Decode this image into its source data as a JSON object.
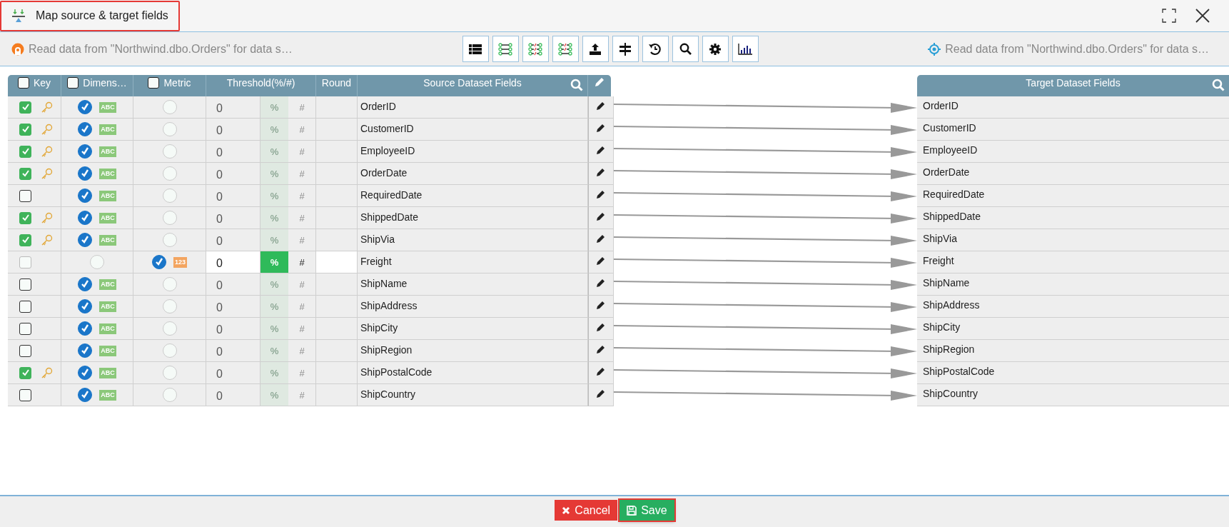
{
  "window": {
    "title": "Map source & target fields"
  },
  "source_status": "Read data from \"Northwind.dbo.Orders\" for data s…",
  "target_status": "Read data from \"Northwind.dbo.Orders\" for data s…",
  "columns": {
    "key": {
      "label": "Key",
      "checked": false
    },
    "dimension": {
      "label": "Dimens…",
      "checked": false
    },
    "metric": {
      "label": "Metric",
      "checked": false
    },
    "threshold": "Threshold(%/#)",
    "round": "Round",
    "source": "Source Dataset Fields",
    "target": "Target Dataset Fields"
  },
  "rows": [
    {
      "key": true,
      "dimension": true,
      "metric": false,
      "badge": "ABC",
      "threshold": "0",
      "percent": "%",
      "hash": "#",
      "source": "OrderID",
      "target": "OrderID"
    },
    {
      "key": true,
      "dimension": true,
      "metric": false,
      "badge": "ABC",
      "threshold": "0",
      "percent": "%",
      "hash": "#",
      "source": "CustomerID",
      "target": "CustomerID"
    },
    {
      "key": true,
      "dimension": true,
      "metric": false,
      "badge": "ABC",
      "threshold": "0",
      "percent": "%",
      "hash": "#",
      "source": "EmployeeID",
      "target": "EmployeeID"
    },
    {
      "key": true,
      "dimension": true,
      "metric": false,
      "badge": "ABC",
      "threshold": "0",
      "percent": "%",
      "hash": "#",
      "source": "OrderDate",
      "target": "OrderDate"
    },
    {
      "key": false,
      "dimension": true,
      "metric": false,
      "badge": "ABC",
      "threshold": "0",
      "percent": "%",
      "hash": "#",
      "source": "RequiredDate",
      "target": "RequiredDate"
    },
    {
      "key": true,
      "dimension": true,
      "metric": false,
      "badge": "ABC",
      "threshold": "0",
      "percent": "%",
      "hash": "#",
      "source": "ShippedDate",
      "target": "ShippedDate"
    },
    {
      "key": true,
      "dimension": true,
      "metric": false,
      "badge": "ABC",
      "threshold": "0",
      "percent": "%",
      "hash": "#",
      "source": "ShipVia",
      "target": "ShipVia"
    },
    {
      "key": false,
      "dimension": false,
      "metric": true,
      "badge": "123",
      "threshold": "0",
      "percent": "%",
      "hash": "#",
      "source": "Freight",
      "target": "Freight"
    },
    {
      "key": false,
      "dimension": true,
      "metric": false,
      "badge": "ABC",
      "threshold": "0",
      "percent": "%",
      "hash": "#",
      "source": "ShipName",
      "target": "ShipName"
    },
    {
      "key": false,
      "dimension": true,
      "metric": false,
      "badge": "ABC",
      "threshold": "0",
      "percent": "%",
      "hash": "#",
      "source": "ShipAddress",
      "target": "ShipAddress"
    },
    {
      "key": false,
      "dimension": true,
      "metric": false,
      "badge": "ABC",
      "threshold": "0",
      "percent": "%",
      "hash": "#",
      "source": "ShipCity",
      "target": "ShipCity"
    },
    {
      "key": false,
      "dimension": true,
      "metric": false,
      "badge": "ABC",
      "threshold": "0",
      "percent": "%",
      "hash": "#",
      "source": "ShipRegion",
      "target": "ShipRegion"
    },
    {
      "key": true,
      "dimension": true,
      "metric": false,
      "badge": "ABC",
      "threshold": "0",
      "percent": "%",
      "hash": "#",
      "source": "ShipPostalCode",
      "target": "ShipPostalCode"
    },
    {
      "key": false,
      "dimension": true,
      "metric": false,
      "badge": "ABC",
      "threshold": "0",
      "percent": "%",
      "hash": "#",
      "source": "ShipCountry",
      "target": "ShipCountry"
    }
  ],
  "buttons": {
    "cancel": "Cancel",
    "save": "Save"
  }
}
